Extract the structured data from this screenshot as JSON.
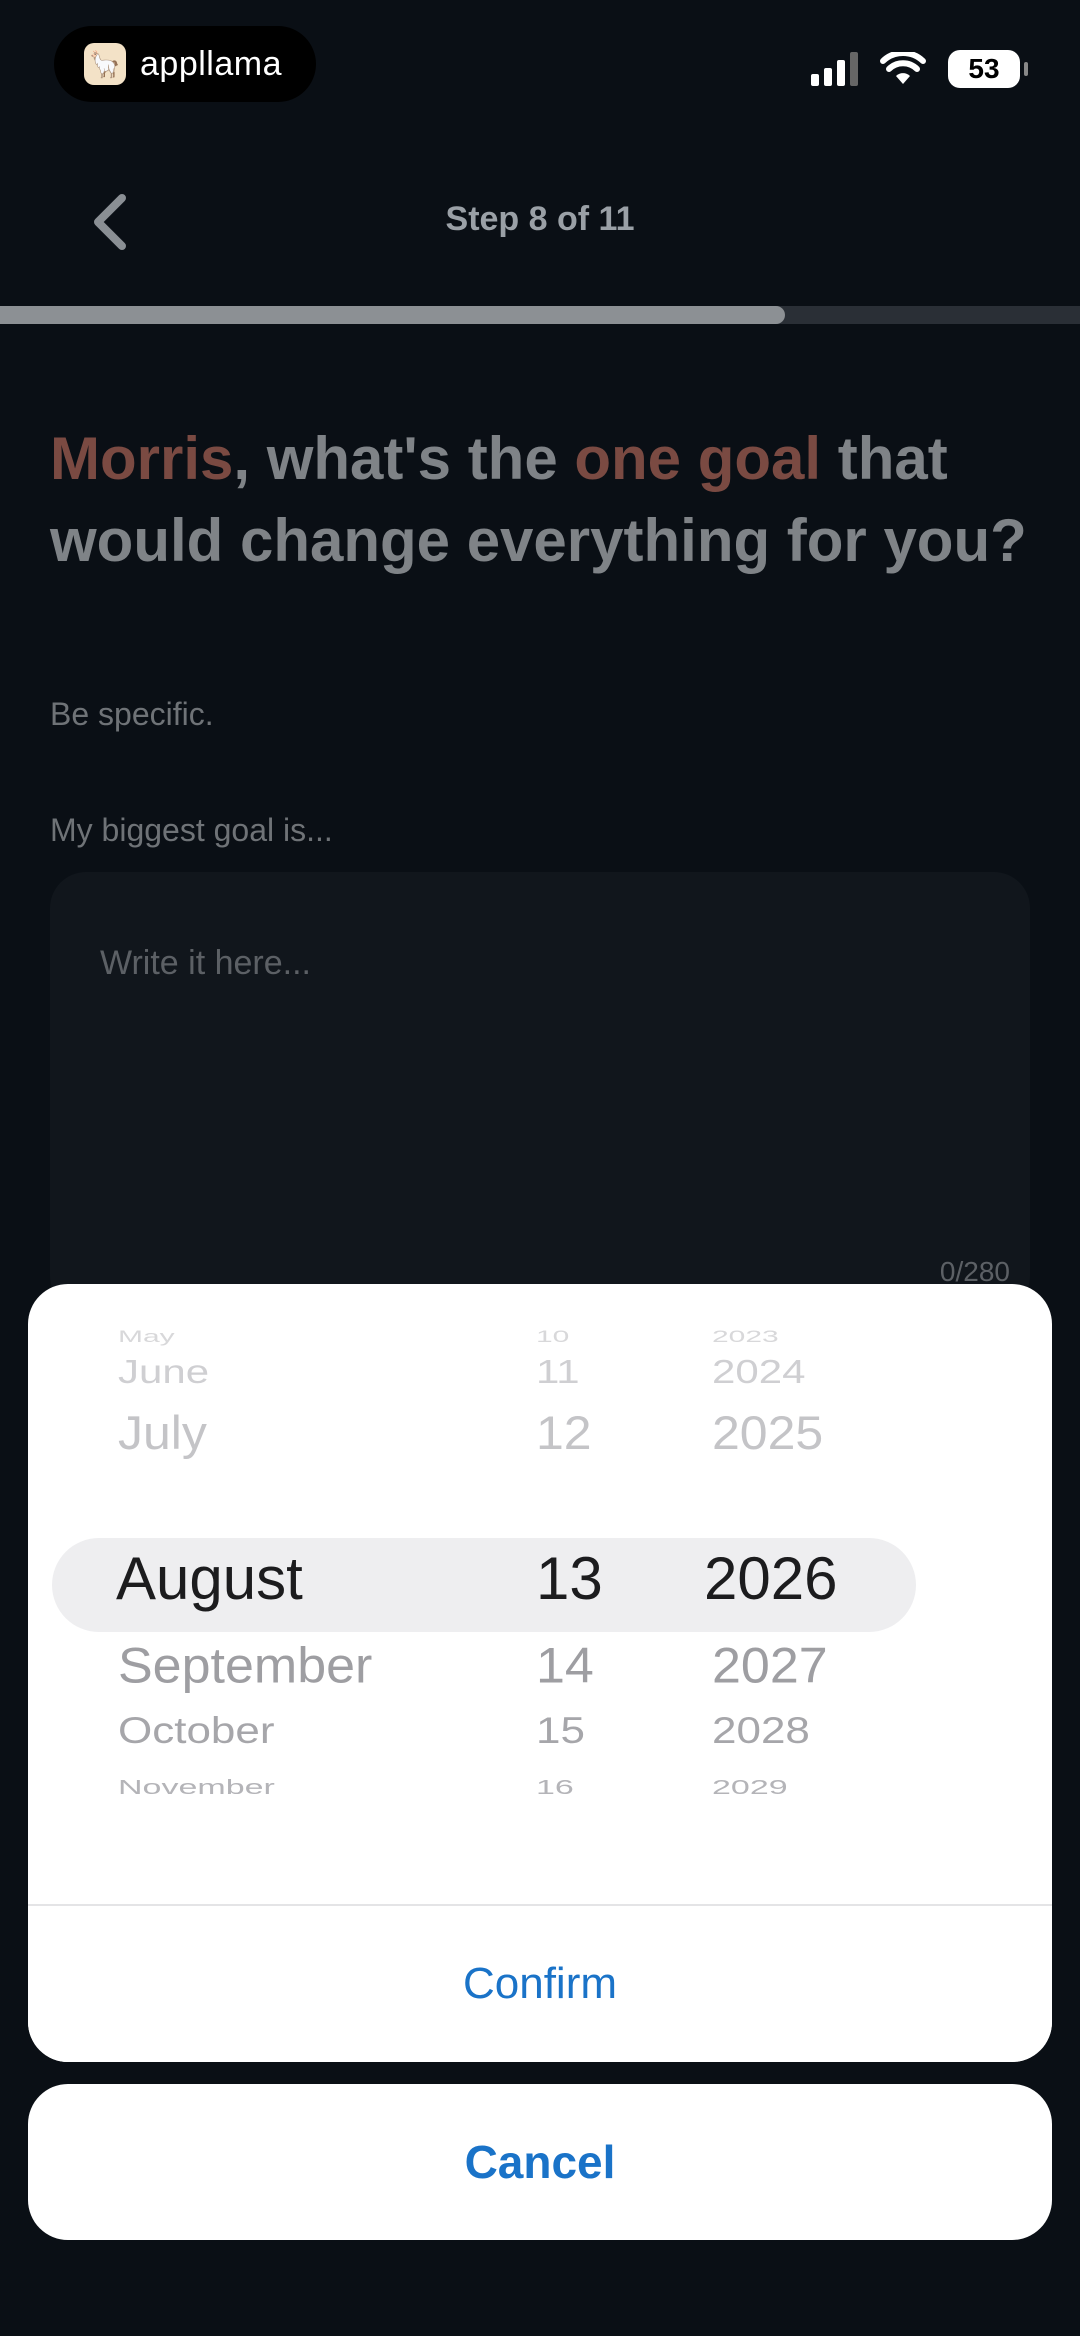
{
  "status_bar": {
    "app_name": "appllama",
    "battery": "53"
  },
  "header": {
    "step_title": "Step 8 of 11",
    "progress_fraction": 0.727
  },
  "question": {
    "name": "Morris",
    "part1": ", what's the ",
    "accent": "one goal",
    "part2": " that would change everything for you?",
    "subtext": "Be specific."
  },
  "goal_field": {
    "label": "My biggest goal is...",
    "placeholder": "Write it here...",
    "counter": "0/280"
  },
  "date_picker": {
    "months": [
      "May",
      "June",
      "July",
      "August",
      "September",
      "October",
      "November"
    ],
    "days": [
      "10",
      "11",
      "12",
      "13",
      "14",
      "15",
      "16"
    ],
    "years": [
      "2023",
      "2024",
      "2025",
      "2026",
      "2027",
      "2028",
      "2029"
    ],
    "selected": {
      "month": "August",
      "day": "13",
      "year": "2026"
    }
  },
  "actions": {
    "confirm": "Confirm",
    "cancel": "Cancel"
  },
  "colors": {
    "background": "#0a0f15",
    "accent_text": "#7a4a42",
    "action_blue": "#1a73c8"
  }
}
